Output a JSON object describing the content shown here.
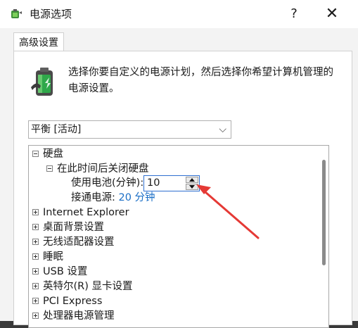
{
  "window": {
    "title": "电源选项",
    "help": "?",
    "close": "✕"
  },
  "tabs": [
    {
      "label": "高级设置"
    }
  ],
  "description": "选择你要自定义的电源计划，然后选择你希望计算机管理的电源设置。",
  "plan_select": {
    "value": "平衡 [活动]"
  },
  "tree": {
    "hard_disk": "硬盘",
    "turn_off_hd": "在此时间后关闭硬盘",
    "on_battery_label": "使用电池(分钟):",
    "on_battery_value": "10",
    "plugged_in_label": "接通电源:",
    "plugged_in_value": "20 分钟",
    "items": [
      "Internet Explorer",
      "桌面背景设置",
      "无线适配器设置",
      "睡眠",
      "USB 设置",
      "英特尔(R) 显卡设置",
      "PCI Express",
      "处理器电源管理"
    ]
  },
  "colors": {
    "accent": "#2e6fd0",
    "arrow": "#e53935",
    "link": "#1a6ec6"
  }
}
